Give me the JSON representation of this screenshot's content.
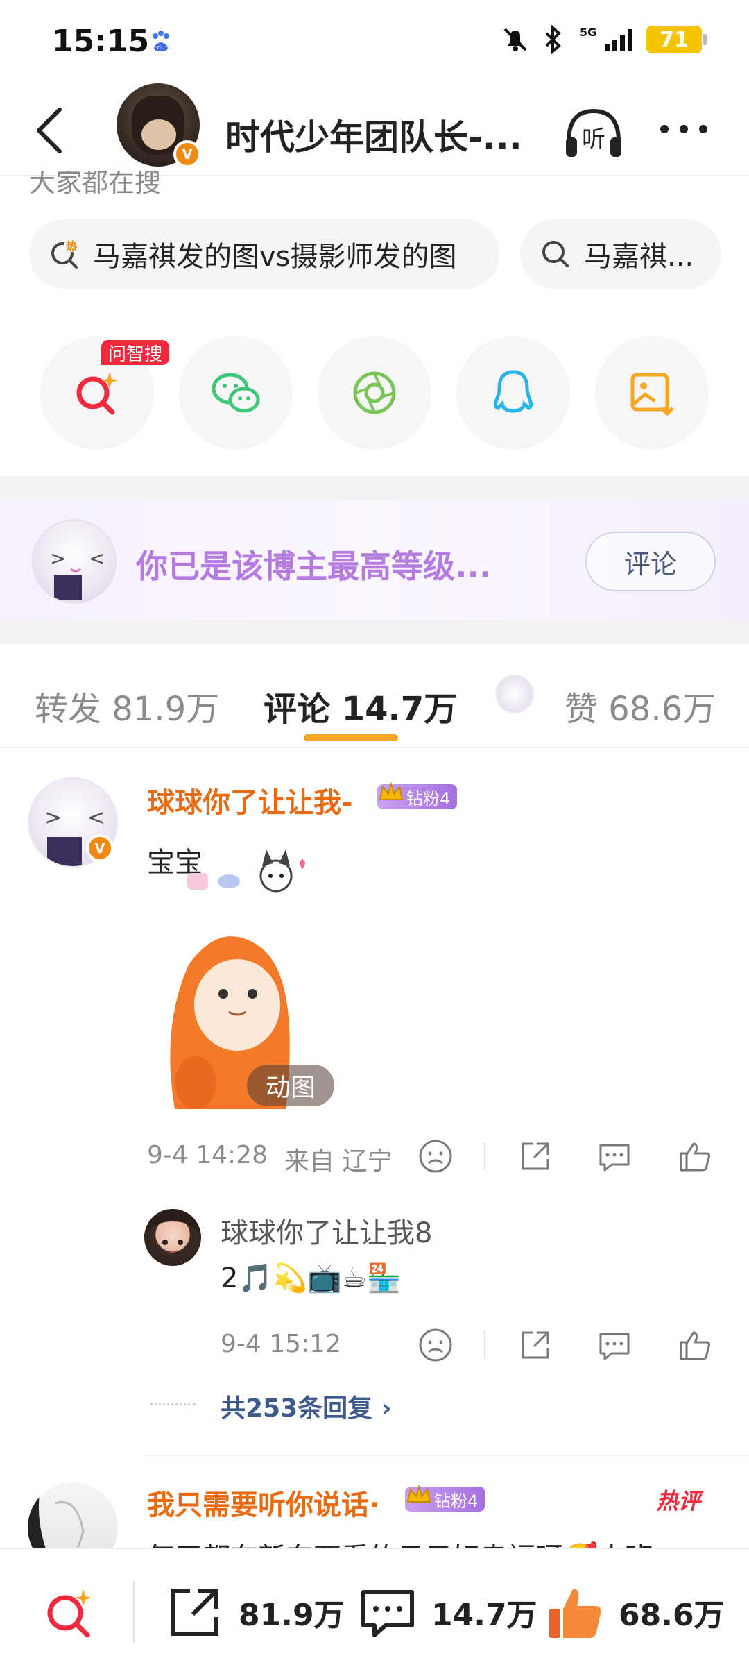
{
  "status_bar": {
    "time": "15:15",
    "battery": "71",
    "network": "5G"
  },
  "header": {
    "title": "时代少年团队长-...",
    "verified_mark": "V",
    "listen_label": "听"
  },
  "search": {
    "label": "大家都在搜",
    "chips": [
      {
        "text": "马嘉祺发的图vs摄影师发的图",
        "icon": "hot-search-icon"
      },
      {
        "text": "马嘉祺...",
        "icon": "search-icon"
      }
    ]
  },
  "share": {
    "ai_tag": "问智搜",
    "buttons": [
      "ai-search-icon",
      "wechat-icon",
      "moments-icon",
      "qq-icon",
      "save-image-icon"
    ]
  },
  "banner": {
    "text": "你已是该博主最高等级...",
    "button": "评论"
  },
  "tabs": [
    {
      "label": "转发 81.9万"
    },
    {
      "label": "评论 14.7万"
    },
    {
      "label": "赞 68.6万"
    }
  ],
  "comments": [
    {
      "user": "球球你了让让我-",
      "badge": "钻粉4",
      "text": "宝宝",
      "gif_label": "动图",
      "time": "9-4 14:28",
      "location": "来自 辽宁",
      "reply": {
        "user": "球球你了让让我8",
        "text": "2🎵💫📺☕🏪",
        "time": "9-4 15:12"
      },
      "more_replies": "共253条回复"
    },
    {
      "user": "我只需要听你说话·",
      "badge": "钻粉4",
      "hot_tag": "热评",
      "text": "每天都有新东西看的日子好幸福呀🥰大班"
    }
  ],
  "bottom_bar": {
    "forward_count": "81.9万",
    "comment_count": "14.7万",
    "like_count": "68.6万"
  },
  "colors": {
    "accent_orange": "#f5a623",
    "username_orange": "#ea6a12",
    "banner_purple": "#b57be0",
    "hot_red": "#f2283c"
  }
}
